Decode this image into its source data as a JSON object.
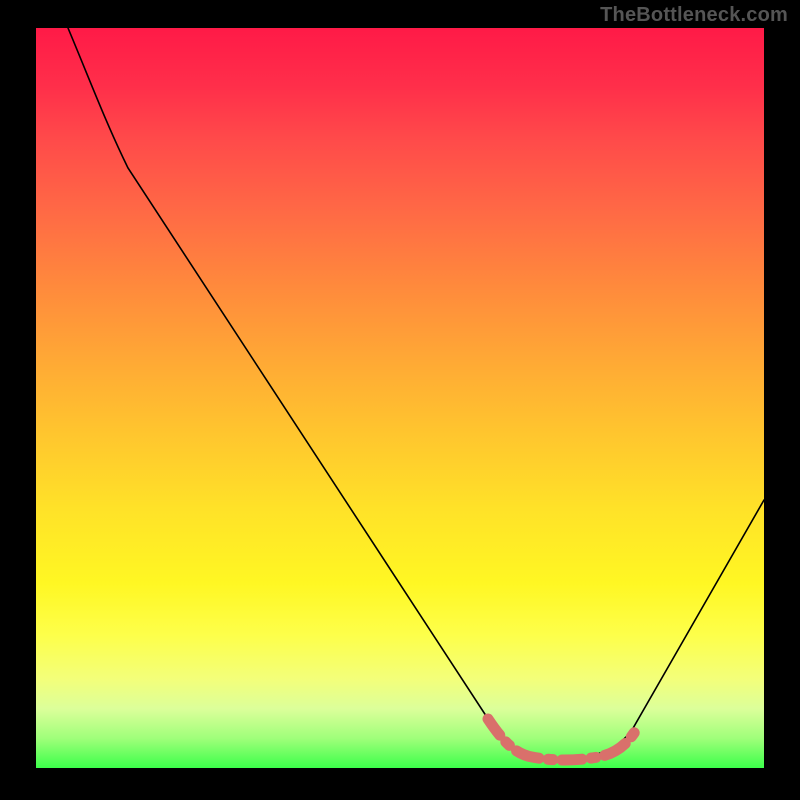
{
  "watermark": "TheBottleneck.com",
  "chart_data": {
    "type": "line",
    "title": "",
    "xlabel": "",
    "ylabel": "",
    "x": [
      0.0,
      0.05,
      0.1,
      0.15,
      0.2,
      0.25,
      0.3,
      0.35,
      0.4,
      0.45,
      0.5,
      0.55,
      0.6,
      0.65,
      0.7,
      0.75,
      0.8,
      0.85,
      0.9,
      0.95,
      1.0
    ],
    "series": [
      {
        "name": "bottleneck-curve",
        "values": [
          1.0,
          0.93,
          0.84,
          0.74,
          0.64,
          0.54,
          0.44,
          0.35,
          0.26,
          0.18,
          0.11,
          0.06,
          0.03,
          0.015,
          0.01,
          0.01,
          0.015,
          0.04,
          0.09,
          0.17,
          0.3
        ]
      }
    ],
    "xlim": [
      0,
      1
    ],
    "ylim": [
      0,
      1
    ],
    "optimal_range_x": [
      0.62,
      0.82
    ],
    "background_gradient": {
      "top": "#ff1a47",
      "mid": "#ffe228",
      "bottom": "#3cff4a"
    }
  }
}
